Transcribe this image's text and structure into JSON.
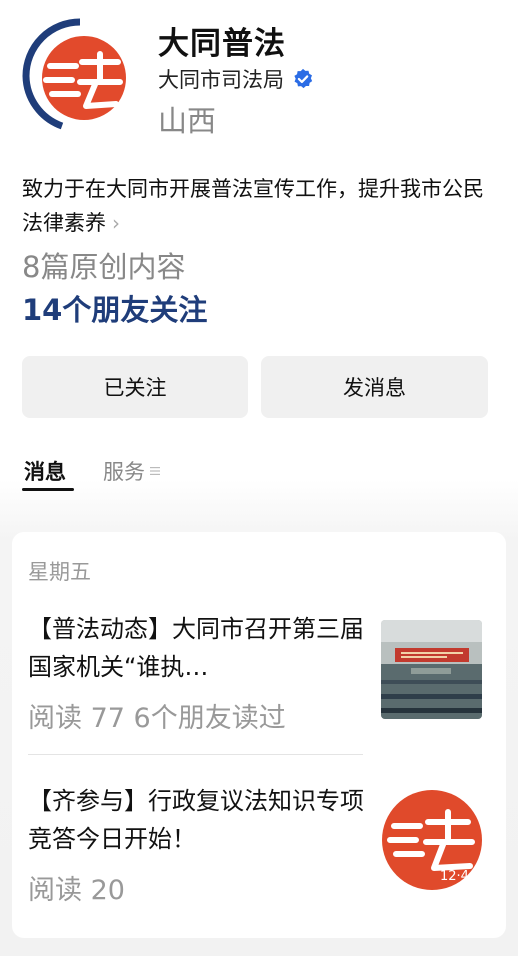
{
  "header": {
    "title": "大同普法",
    "org": "大同市司法局",
    "region": "山西",
    "avatar_icon": "law-logo-icon",
    "verified_icon": "verified-badge-icon"
  },
  "profile": {
    "description": "致力于在大同市开展普法宣传工作，提升我市公民法律素养",
    "description_chevron": "›",
    "original_count": "8篇原创内容",
    "friends_following": "14个朋友关注"
  },
  "actions": {
    "follow_label": "已关注",
    "message_label": "发消息"
  },
  "tabs": [
    {
      "label": "消息",
      "active": true
    },
    {
      "label": "服务",
      "active": false,
      "icon": "menu-icon"
    }
  ],
  "feed": {
    "day": "星期五",
    "articles": [
      {
        "title": "【普法动态】大同市召开第三届国家机关“谁执…",
        "meta": "阅读 77   6个朋友读过",
        "thumb_icon": "meeting-photo"
      },
      {
        "title": "【齐参与】行政复议法知识专项竞答今日开始！",
        "meta": "阅读 20",
        "thumb_icon": "law-logo-icon",
        "thumb_text": "12·4"
      }
    ]
  },
  "colors": {
    "brand_red": "#e04a2b",
    "brand_blue": "#1f3d7a",
    "verified_blue": "#2b6ce5"
  }
}
